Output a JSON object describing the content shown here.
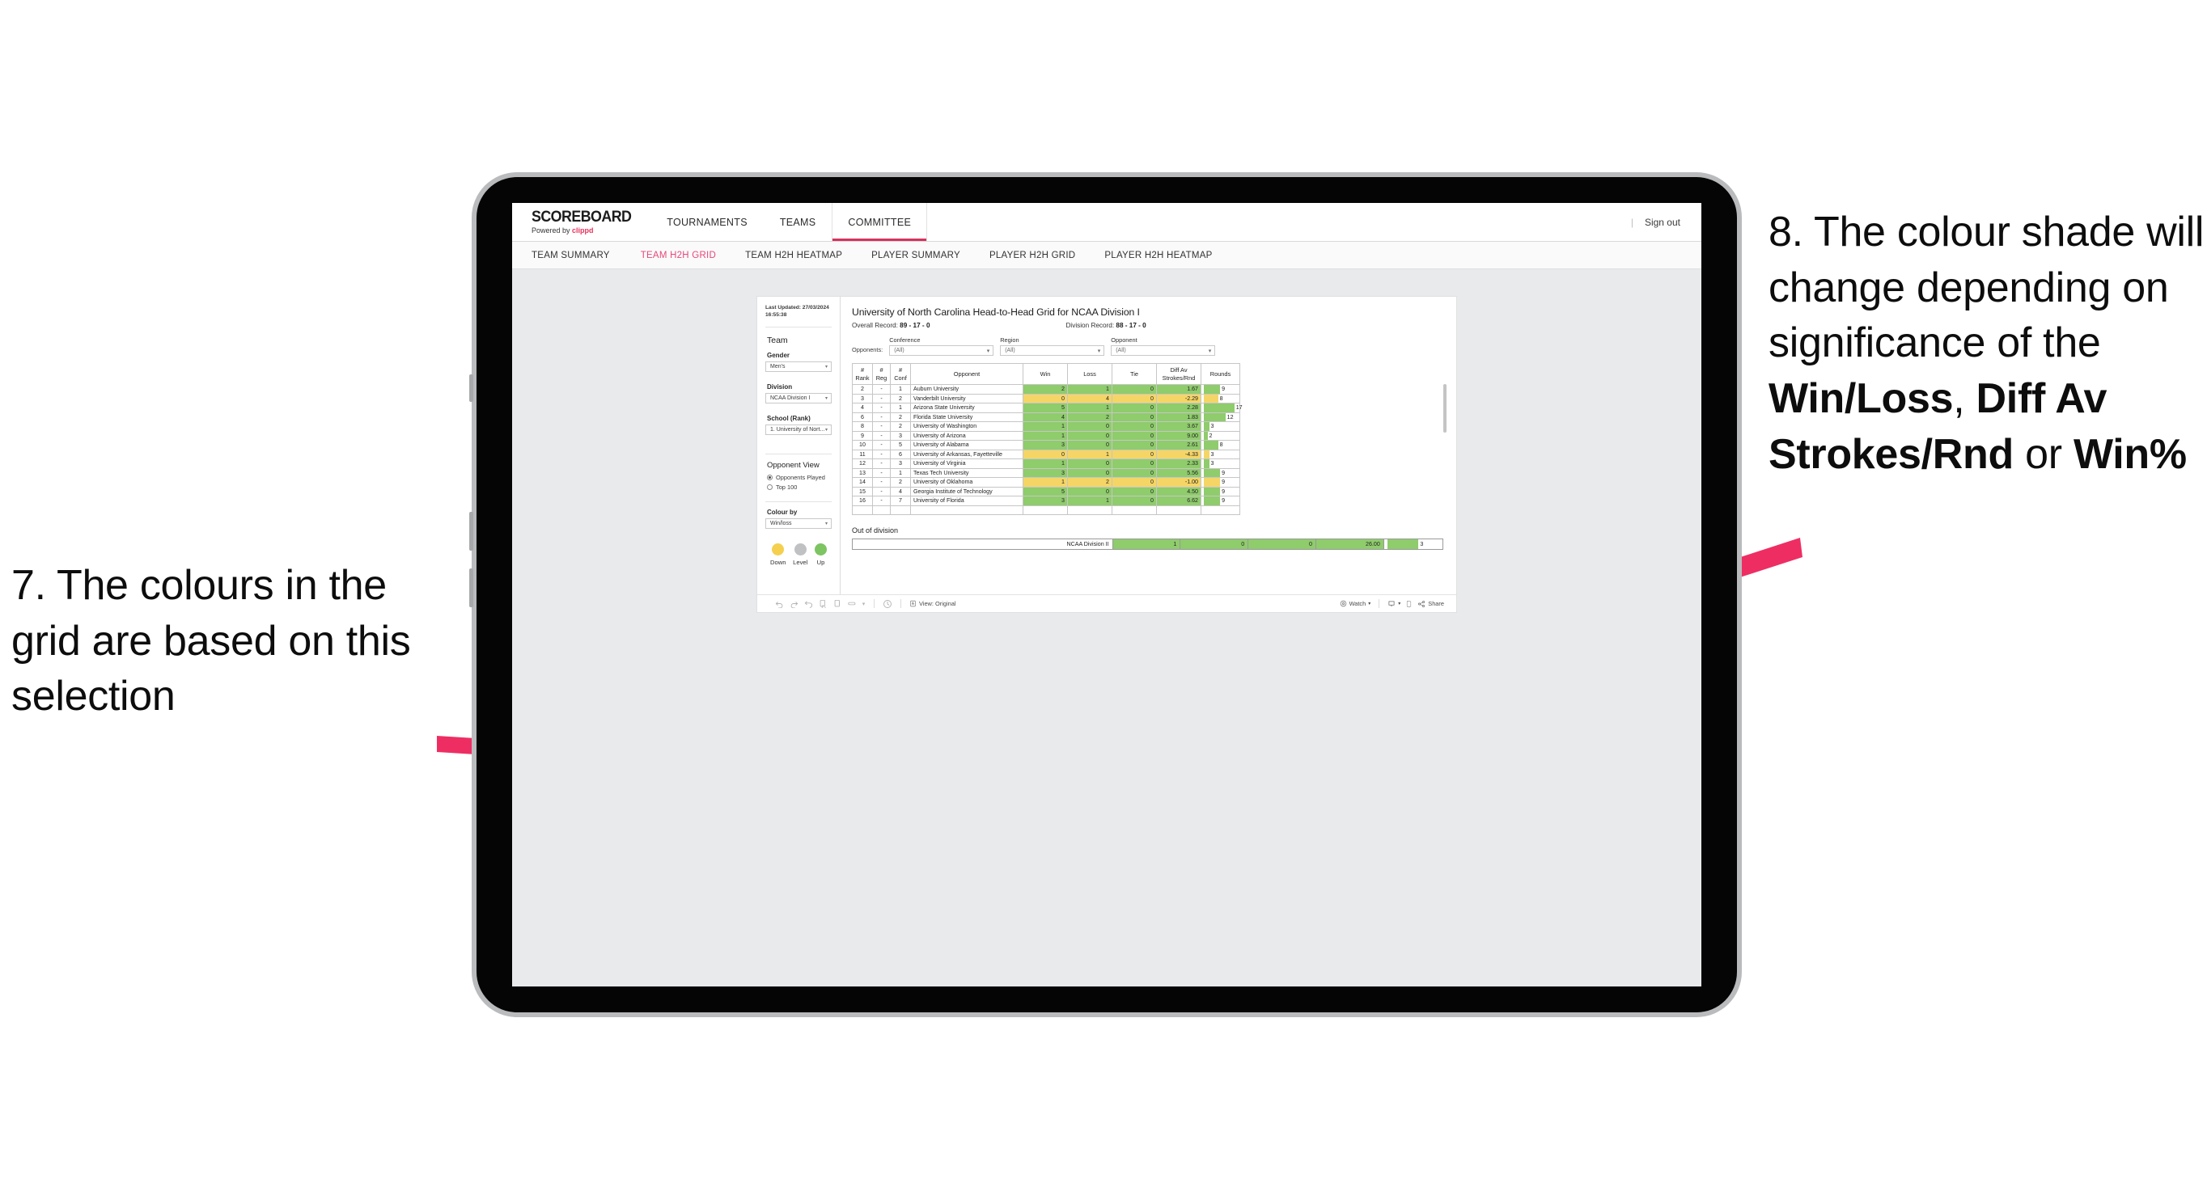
{
  "annotations": {
    "left": {
      "number": "7.",
      "text": "7. The colours in the grid are based on this selection"
    },
    "right": {
      "segments": [
        {
          "text": "8. The colour shade will change depending on significance of the ",
          "bold": false
        },
        {
          "text": "Win/Loss",
          "bold": true
        },
        {
          "text": ", ",
          "bold": false
        },
        {
          "text": "Diff Av Strokes/Rnd",
          "bold": true
        },
        {
          "text": " or ",
          "bold": false
        },
        {
          "text": "Win%",
          "bold": true
        }
      ]
    },
    "arrow_color": "#ee2e63"
  },
  "header": {
    "brand_title": "SCOREBOARD",
    "brand_sub_prefix": "Powered by ",
    "brand_sub_name": "clippd",
    "nav": [
      {
        "label": "TOURNAMENTS",
        "active": false
      },
      {
        "label": "TEAMS",
        "active": false
      },
      {
        "label": "COMMITTEE",
        "active": true
      }
    ],
    "divider": "|",
    "sign_out": "Sign out",
    "accent": "#d8315c"
  },
  "subnav": {
    "items": [
      {
        "label": "TEAM SUMMARY",
        "active": false
      },
      {
        "label": "TEAM H2H GRID",
        "active": true
      },
      {
        "label": "TEAM H2H HEATMAP",
        "active": false
      },
      {
        "label": "PLAYER SUMMARY",
        "active": false
      },
      {
        "label": "PLAYER H2H GRID",
        "active": false
      },
      {
        "label": "PLAYER H2H HEATMAP",
        "active": false
      }
    ],
    "active_color": "#e8477a"
  },
  "sidebar": {
    "last_updated": "Last Updated: 27/03/2024 16:55:38",
    "team_heading": "Team",
    "fields": [
      {
        "label": "Gender",
        "value": "Men's"
      },
      {
        "label": "Division",
        "value": "NCAA Division I"
      },
      {
        "label": "School (Rank)",
        "value": "1. University of Nort..."
      }
    ],
    "opponent_view": {
      "heading": "Opponent View",
      "options": [
        {
          "label": "Opponents Played",
          "selected": true
        },
        {
          "label": "Top 100",
          "selected": false
        }
      ]
    },
    "colour_by": {
      "label": "Colour by",
      "value": "Win/loss"
    },
    "legend": [
      {
        "label": "Down",
        "color": "#f5d04e"
      },
      {
        "label": "Level",
        "color": "#bfc1c3"
      },
      {
        "label": "Up",
        "color": "#7dc462"
      }
    ]
  },
  "main": {
    "title": "University of North Carolina Head-to-Head Grid for NCAA Division I",
    "overall_record_label": "Overall Record:",
    "overall_record_value": "89 - 17 - 0",
    "division_record_label": "Division Record:",
    "division_record_value": "88 - 17 - 0",
    "opponents_label": "Opponents:",
    "filters": [
      {
        "label": "Conference",
        "value": "(All)"
      },
      {
        "label": "Region",
        "value": "(All)"
      },
      {
        "label": "Opponent",
        "value": "(All)"
      }
    ],
    "columns": [
      "# Rank",
      "# Reg",
      "# Conf",
      "Opponent",
      "Win",
      "Loss",
      "Tie",
      "Diff Av Strokes/Rnd",
      "Rounds"
    ],
    "column_lines": {
      "rank": [
        "#",
        "Rank"
      ],
      "reg": [
        "#",
        "Reg"
      ],
      "conf": [
        "#",
        "Conf"
      ],
      "opponent": [
        "Opponent"
      ],
      "win": [
        "Win"
      ],
      "loss": [
        "Loss"
      ],
      "tie": [
        "Tie"
      ],
      "diff": [
        "Diff Av",
        "Strokes/Rnd"
      ],
      "rounds": [
        "Rounds"
      ]
    },
    "rows": [
      {
        "rank": "2",
        "reg": "-",
        "conf": "1",
        "opponent": "Auburn University",
        "win": "2",
        "loss": "1",
        "tie": "0",
        "diff": "1.67",
        "rounds": "9",
        "shade": "up"
      },
      {
        "rank": "3",
        "reg": "-",
        "conf": "2",
        "opponent": "Vanderbilt University",
        "win": "0",
        "loss": "4",
        "tie": "0",
        "diff": "-2.29",
        "rounds": "8",
        "shade": "down"
      },
      {
        "rank": "4",
        "reg": "-",
        "conf": "1",
        "opponent": "Arizona State University",
        "win": "5",
        "loss": "1",
        "tie": "0",
        "diff": "2.28",
        "rounds": "17",
        "shade": "up"
      },
      {
        "rank": "6",
        "reg": "-",
        "conf": "2",
        "opponent": "Florida State University",
        "win": "4",
        "loss": "2",
        "tie": "0",
        "diff": "1.83",
        "rounds": "12",
        "shade": "up"
      },
      {
        "rank": "8",
        "reg": "-",
        "conf": "2",
        "opponent": "University of Washington",
        "win": "1",
        "loss": "0",
        "tie": "0",
        "diff": "3.67",
        "rounds": "3",
        "shade": "up"
      },
      {
        "rank": "9",
        "reg": "-",
        "conf": "3",
        "opponent": "University of Arizona",
        "win": "1",
        "loss": "0",
        "tie": "0",
        "diff": "9.00",
        "rounds": "2",
        "shade": "up"
      },
      {
        "rank": "10",
        "reg": "-",
        "conf": "5",
        "opponent": "University of Alabama",
        "win": "3",
        "loss": "0",
        "tie": "0",
        "diff": "2.61",
        "rounds": "8",
        "shade": "up"
      },
      {
        "rank": "11",
        "reg": "-",
        "conf": "6",
        "opponent": "University of Arkansas, Fayetteville",
        "win": "0",
        "loss": "1",
        "tie": "0",
        "diff": "-4.33",
        "rounds": "3",
        "shade": "down"
      },
      {
        "rank": "12",
        "reg": "-",
        "conf": "3",
        "opponent": "University of Virginia",
        "win": "1",
        "loss": "0",
        "tie": "0",
        "diff": "2.33",
        "rounds": "3",
        "shade": "up"
      },
      {
        "rank": "13",
        "reg": "-",
        "conf": "1",
        "opponent": "Texas Tech University",
        "win": "3",
        "loss": "0",
        "tie": "0",
        "diff": "5.56",
        "rounds": "9",
        "shade": "up"
      },
      {
        "rank": "14",
        "reg": "-",
        "conf": "2",
        "opponent": "University of Oklahoma",
        "win": "1",
        "loss": "2",
        "tie": "0",
        "diff": "-1.00",
        "rounds": "9",
        "shade": "down"
      },
      {
        "rank": "15",
        "reg": "-",
        "conf": "4",
        "opponent": "Georgia Institute of Technology",
        "win": "5",
        "loss": "0",
        "tie": "0",
        "diff": "4.50",
        "rounds": "9",
        "shade": "up"
      },
      {
        "rank": "16",
        "reg": "-",
        "conf": "7",
        "opponent": "University of Florida",
        "win": "3",
        "loss": "1",
        "tie": "0",
        "diff": "6.62",
        "rounds": "9",
        "shade": "up"
      }
    ],
    "out_of_division": {
      "title": "Out of division",
      "row": {
        "name": "NCAA Division II",
        "win": "1",
        "loss": "0",
        "tie": "0",
        "diff": "26.00",
        "rounds": "3",
        "shade": "up"
      }
    },
    "shade_colors": {
      "up": "#8fcc6c",
      "down": "#f5d565",
      "level": "#bfc1c3"
    }
  },
  "toolbar": {
    "view_label": "View: Original",
    "watch_label": "Watch",
    "share_label": "Share",
    "caret": "▾"
  },
  "chart_data": {
    "type": "table",
    "title": "University of North Carolina Head-to-Head Grid for NCAA Division I",
    "categories": [
      "Auburn University",
      "Vanderbilt University",
      "Arizona State University",
      "Florida State University",
      "University of Washington",
      "University of Arizona",
      "University of Alabama",
      "University of Arkansas, Fayetteville",
      "University of Virginia",
      "Texas Tech University",
      "University of Oklahoma",
      "Georgia Institute of Technology",
      "University of Florida"
    ],
    "series": [
      {
        "name": "Win",
        "values": [
          2,
          0,
          5,
          4,
          1,
          1,
          3,
          0,
          1,
          3,
          1,
          5,
          3
        ]
      },
      {
        "name": "Loss",
        "values": [
          1,
          4,
          1,
          2,
          0,
          0,
          0,
          1,
          0,
          0,
          2,
          0,
          1
        ]
      },
      {
        "name": "Tie",
        "values": [
          0,
          0,
          0,
          0,
          0,
          0,
          0,
          0,
          0,
          0,
          0,
          0,
          0
        ]
      },
      {
        "name": "Diff Av Strokes/Rnd",
        "values": [
          1.67,
          -2.29,
          2.28,
          1.83,
          3.67,
          9.0,
          2.61,
          -4.33,
          2.33,
          5.56,
          -1.0,
          4.5,
          6.62
        ]
      },
      {
        "name": "Rounds",
        "values": [
          9,
          8,
          17,
          12,
          3,
          2,
          8,
          3,
          3,
          9,
          9,
          9,
          9
        ]
      }
    ],
    "colour_by": "Win/loss",
    "legend": [
      "Down",
      "Level",
      "Up"
    ],
    "xlabel": "Opponent",
    "ylabel": ""
  }
}
